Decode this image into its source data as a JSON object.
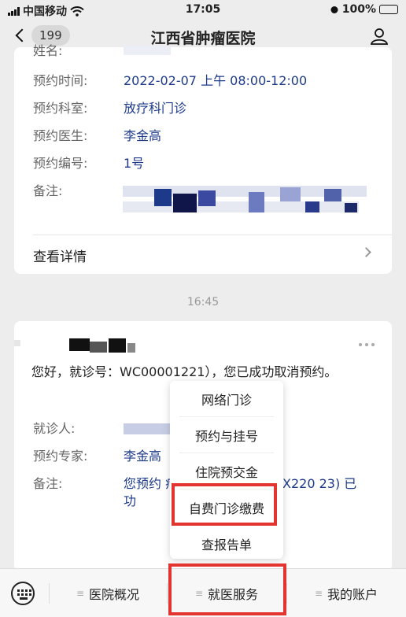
{
  "status": {
    "carrier": "中国移动",
    "time": "17:05",
    "battery": "100%"
  },
  "nav": {
    "back_count": "199",
    "title": "江西省肿瘤医院"
  },
  "card1": {
    "partial_label": "姓名:",
    "rows": [
      {
        "label": "预约时间:",
        "value": "2022-02-07 上午 08:00-12:00"
      },
      {
        "label": "预约科室:",
        "value": "放疗科门诊"
      },
      {
        "label": "预约医生:",
        "value": "李金高"
      },
      {
        "label": "预约编号:",
        "value": "1号"
      },
      {
        "label": "备注:",
        "value": ""
      }
    ],
    "detail_label": "查看详情"
  },
  "timestamp": "16:45",
  "card2": {
    "greeting": "您好，就诊号：WC00001221），您已成功取消预约。",
    "rows": [
      {
        "label": "就诊人:",
        "value": ""
      },
      {
        "label": "预约专家:",
        "value": "李金高"
      },
      {
        "label": "备注:",
        "value": "您预约 疗科门诊下的医生 WX220 23) 已 功"
      }
    ]
  },
  "popup_menu": [
    "网络门诊",
    "预约与挂号",
    "住院预交金",
    "自费门诊缴费",
    "查报告单"
  ],
  "tabbar": {
    "tabs": [
      "医院概况",
      "就医服务",
      "我的账户"
    ]
  },
  "colors": {
    "highlight": "#e3342f",
    "link_value": "#1d3a8a"
  }
}
